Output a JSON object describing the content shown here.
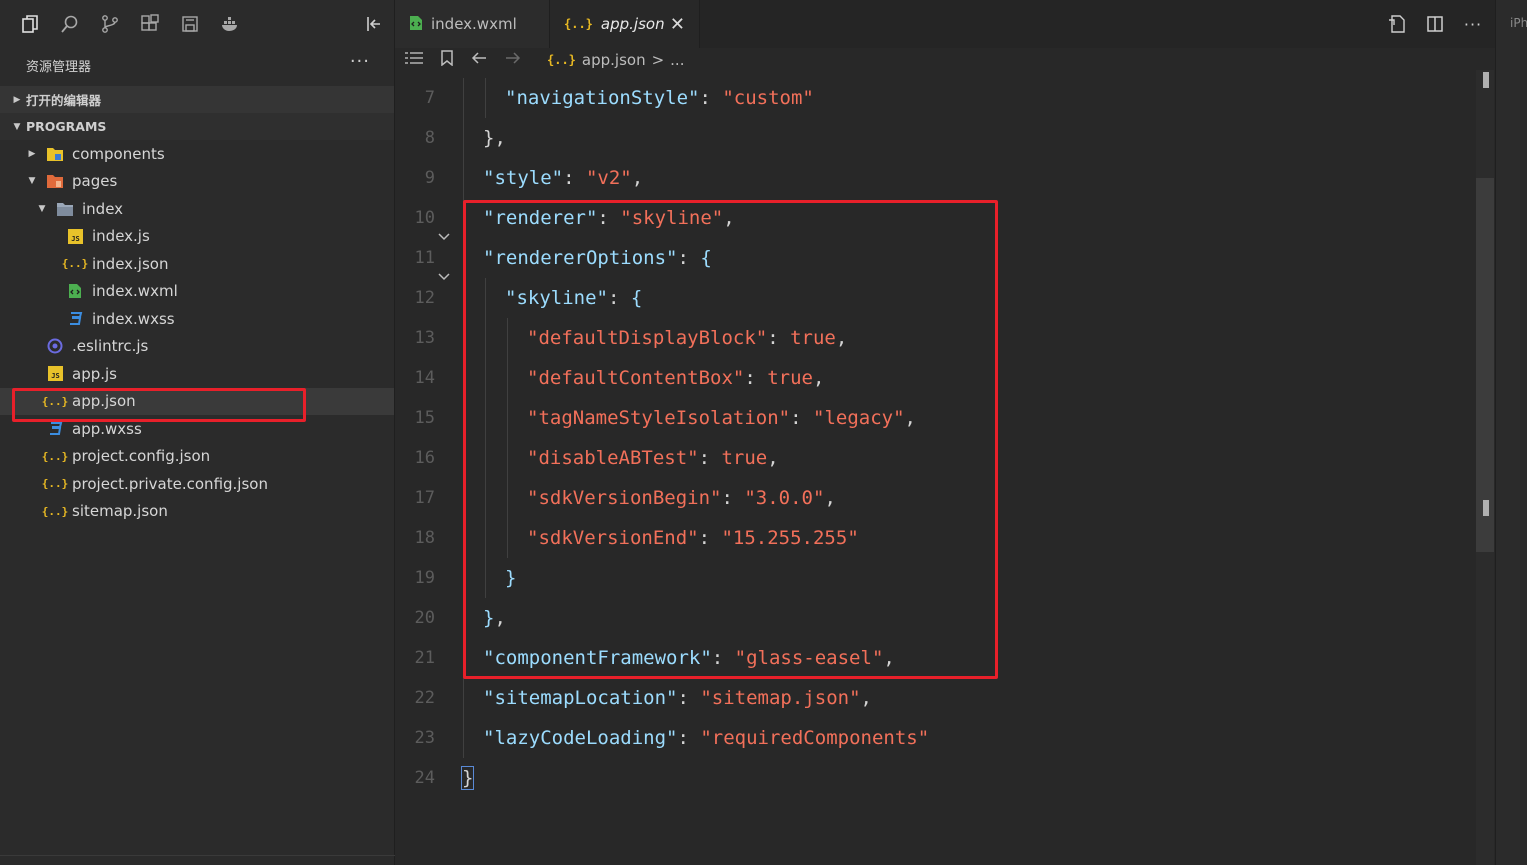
{
  "sidebar": {
    "activity_icons": [
      "files-icon",
      "search-icon",
      "source-control-icon",
      "extensions-icon",
      "save-icon",
      "docker-icon"
    ],
    "explorer_title": "资源管理器",
    "more_label": "···",
    "open_editors_label": "打开的编辑器",
    "programs_label": "PROGRAMS",
    "tree": [
      {
        "name": "components",
        "type": "folder",
        "depth": 1,
        "expanded": false
      },
      {
        "name": "pages",
        "type": "folder",
        "depth": 1,
        "expanded": true
      },
      {
        "name": "index",
        "type": "folder",
        "depth": 2,
        "expanded": true
      },
      {
        "name": "index.js",
        "type": "js",
        "depth": 3
      },
      {
        "name": "index.json",
        "type": "json",
        "depth": 3
      },
      {
        "name": "index.wxml",
        "type": "wxml",
        "depth": 3
      },
      {
        "name": "index.wxss",
        "type": "wxss",
        "depth": 3
      },
      {
        "name": ".eslintrc.js",
        "type": "eslint",
        "depth": 1
      },
      {
        "name": "app.js",
        "type": "js",
        "depth": 1
      },
      {
        "name": "app.json",
        "type": "json",
        "depth": 1,
        "selected": true
      },
      {
        "name": "app.wxss",
        "type": "wxss",
        "depth": 1
      },
      {
        "name": "project.config.json",
        "type": "json",
        "depth": 1
      },
      {
        "name": "project.private.config.json",
        "type": "json",
        "depth": 1
      },
      {
        "name": "sitemap.json",
        "type": "json",
        "depth": 1
      }
    ]
  },
  "tabs": [
    {
      "label": "index.wxml",
      "active": false
    },
    {
      "label": "app.json",
      "active": true
    }
  ],
  "breadcrumb": {
    "file": "app.json",
    "separator": ">",
    "ellipsis": "..."
  },
  "right_strip_label": "iPh",
  "code_lines": [
    {
      "n": "7",
      "indent": 2,
      "tokens": [
        [
          "k",
          "\"navigationStyle\""
        ],
        [
          "p",
          ": "
        ],
        [
          "s",
          "\"custom\""
        ]
      ]
    },
    {
      "n": "8",
      "indent": 1,
      "tokens": [
        [
          "p",
          "},"
        ]
      ]
    },
    {
      "n": "9",
      "indent": 1,
      "tokens": [
        [
          "k",
          "\"style\""
        ],
        [
          "p",
          ": "
        ],
        [
          "s",
          "\"v2\""
        ],
        [
          "p",
          ","
        ]
      ]
    },
    {
      "n": "10",
      "indent": 1,
      "tokens": [
        [
          "k",
          "\"renderer\""
        ],
        [
          "p",
          ": "
        ],
        [
          "s",
          "\"skyline\""
        ],
        [
          "p",
          ","
        ]
      ]
    },
    {
      "n": "11",
      "indent": 1,
      "fold": true,
      "tokens": [
        [
          "k",
          "\"rendererOptions\""
        ],
        [
          "p",
          ": "
        ],
        [
          "k",
          "{"
        ]
      ]
    },
    {
      "n": "12",
      "indent": 2,
      "fold": true,
      "tokens": [
        [
          "k",
          "\"skyline\""
        ],
        [
          "p",
          ": "
        ],
        [
          "k",
          "{"
        ]
      ]
    },
    {
      "n": "13",
      "indent": 3,
      "tokens": [
        [
          "s",
          "\"defaultDisplayBlock\""
        ],
        [
          "p",
          ": "
        ],
        [
          "b",
          "true"
        ],
        [
          "p",
          ","
        ]
      ]
    },
    {
      "n": "14",
      "indent": 3,
      "tokens": [
        [
          "s",
          "\"defaultContentBox\""
        ],
        [
          "p",
          ": "
        ],
        [
          "b",
          "true"
        ],
        [
          "p",
          ","
        ]
      ]
    },
    {
      "n": "15",
      "indent": 3,
      "tokens": [
        [
          "s",
          "\"tagNameStyleIsolation\""
        ],
        [
          "p",
          ": "
        ],
        [
          "s",
          "\"legacy\""
        ],
        [
          "p",
          ","
        ]
      ]
    },
    {
      "n": "16",
      "indent": 3,
      "tokens": [
        [
          "s",
          "\"disableABTest\""
        ],
        [
          "p",
          ": "
        ],
        [
          "b",
          "true"
        ],
        [
          "p",
          ","
        ]
      ]
    },
    {
      "n": "17",
      "indent": 3,
      "tokens": [
        [
          "s",
          "\"sdkVersionBegin\""
        ],
        [
          "p",
          ": "
        ],
        [
          "s",
          "\"3.0.0\""
        ],
        [
          "p",
          ","
        ]
      ]
    },
    {
      "n": "18",
      "indent": 3,
      "tokens": [
        [
          "s",
          "\"sdkVersionEnd\""
        ],
        [
          "p",
          ": "
        ],
        [
          "s",
          "\"15.255.255\""
        ]
      ]
    },
    {
      "n": "19",
      "indent": 2,
      "tokens": [
        [
          "k",
          "}"
        ]
      ]
    },
    {
      "n": "20",
      "indent": 1,
      "tokens": [
        [
          "k",
          "}"
        ],
        [
          "p",
          ","
        ]
      ]
    },
    {
      "n": "21",
      "indent": 1,
      "tokens": [
        [
          "k",
          "\"componentFramework\""
        ],
        [
          "p",
          ": "
        ],
        [
          "s",
          "\"glass-easel\""
        ],
        [
          "p",
          ","
        ]
      ]
    },
    {
      "n": "22",
      "indent": 1,
      "tokens": [
        [
          "k",
          "\"sitemapLocation\""
        ],
        [
          "p",
          ": "
        ],
        [
          "s",
          "\"sitemap.json\""
        ],
        [
          "p",
          ","
        ]
      ]
    },
    {
      "n": "23",
      "indent": 1,
      "tokens": [
        [
          "k",
          "\"lazyCodeLoading\""
        ],
        [
          "p",
          ": "
        ],
        [
          "s",
          "\"requiredComponents\""
        ]
      ]
    },
    {
      "n": "24",
      "indent": 0,
      "tokens": [
        [
          "p",
          "}"
        ]
      ]
    }
  ],
  "colors": {
    "highlight_box": "#e8202a",
    "key": "#9cdcfe",
    "string": "#f2705a",
    "json_icon": "#e8b923",
    "js_icon": "#e8c22a",
    "wxml_icon": "#4caf50",
    "wxss_icon": "#3b8de0"
  }
}
